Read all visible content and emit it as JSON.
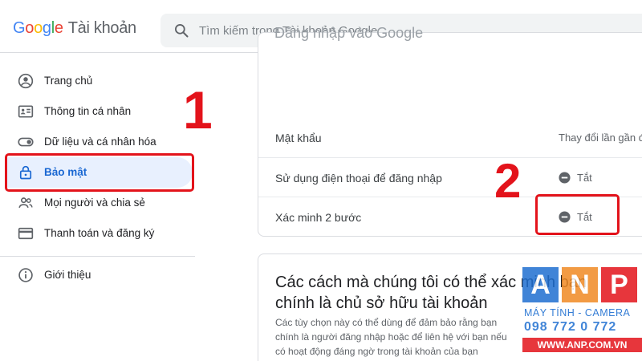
{
  "header": {
    "logo_text": "Google",
    "product_name": "Tài khoản",
    "search_placeholder": "Tìm kiếm trong Tài khoản Google"
  },
  "sidebar": {
    "items": [
      {
        "label": "Trang chủ",
        "icon": "account-circle-icon"
      },
      {
        "label": "Thông tin cá nhân",
        "icon": "id-card-icon"
      },
      {
        "label": "Dữ liệu và cá nhân hóa",
        "icon": "toggle-icon"
      },
      {
        "label": "Bảo mật",
        "icon": "lock-icon",
        "active": true
      },
      {
        "label": "Mọi người và chia sẻ",
        "icon": "people-icon"
      },
      {
        "label": "Thanh toán và đăng ký",
        "icon": "credit-card-icon"
      },
      {
        "label": "Giới thiệu",
        "icon": "info-icon"
      }
    ]
  },
  "annotations": {
    "step1": "1",
    "step2": "2"
  },
  "signin_card": {
    "cut_title": "Đăng nhập vào Google",
    "rows": [
      {
        "label": "Mật khẩu",
        "value": "Thay đổi lần gần đ"
      },
      {
        "label": "Sử dụng điện thoại để đăng nhập",
        "value": "Tắt",
        "status_icon": "minus-circle-icon"
      },
      {
        "label": "Xác minh 2 bước",
        "value": "Tắt",
        "status_icon": "minus-circle-icon"
      }
    ]
  },
  "verify_card": {
    "title": "Các cách mà chúng tôi có thể xác minh bạn chính là chủ sở hữu tài khoản",
    "description": "Các tùy chọn này có thể dùng để đảm bảo rằng bạn chính là người đăng nhập hoặc để liên hệ với bạn nếu có hoạt động đáng ngờ trong tài khoản của bạn"
  },
  "watermark": {
    "letters": [
      "A",
      "N",
      "P"
    ],
    "tagline": "MÁY TÍNH - CAMERA",
    "phone": "098 772 0 772",
    "website": "WWW.ANP.COM.VN"
  },
  "colors": {
    "accent_blue": "#1967d2",
    "active_bg": "#e8f0fe",
    "annotation_red": "#e3131b"
  }
}
